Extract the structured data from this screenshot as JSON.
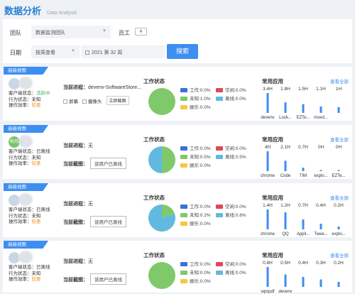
{
  "header": {
    "title": "数据分析",
    "subtitle": "Data Analysis"
  },
  "filter": {
    "team_label": "团队",
    "team_value": "数据监测团队",
    "member_label": "员工",
    "add_label": "+",
    "date_label": "日期",
    "date_mode": "按周查看",
    "week_value": "2021 第 32 周",
    "search_label": "搜索"
  },
  "colors": {
    "work": "#3d6fd8",
    "idle": "#e2465a",
    "unknown": "#7fc96a",
    "offline": "#62b9df",
    "entertain": "#f5c842",
    "accent": "#3d8ef0"
  },
  "labels": {
    "badge": "高级视图",
    "client_status": "客户端状态：",
    "behavior_status": "行为状态：",
    "efficiency": "操作效率：",
    "current_process": "当前进程：",
    "current_screenshot": "当前截图：",
    "request_screenshot": "该用户已离线",
    "work_status": "工作状态",
    "common_apps": "常用应用",
    "view_all": "查看全部",
    "screen": "屏幕",
    "camera": "摄像头",
    "instant_capture": "立即截图"
  },
  "cards": [
    {
      "avatar_text": "",
      "client_status": "活跃中",
      "client_status_kind": "ok",
      "behavior_status": "未知",
      "efficiency": "较差",
      "process": "devenv-SoftwareStore...",
      "has_checks": true,
      "legend": {
        "work": "工作:0.0%",
        "idle": "空闲:0.0%",
        "unknown": "未知:1.0%",
        "offline": "离线:0.0%",
        "entertain": "娱乐:0.0%"
      },
      "pie": [
        {
          "key": "unknown",
          "value": 100
        }
      ],
      "chart_data": {
        "type": "bar",
        "categories": [
          "devenv",
          "Lock...",
          "EZTe...",
          "msed...",
          ""
        ],
        "values": [
          3.4,
          1.8,
          1.5,
          1.1,
          1
        ],
        "labels": [
          "3.4H",
          "1.8H",
          "1.5H",
          "1.1H",
          "1H"
        ]
      }
    },
    {
      "avatar_text": "秋月",
      "client_status": "已离线",
      "client_status_kind": "v",
      "behavior_status": "未知",
      "efficiency": "较差",
      "process": "无",
      "has_checks": false,
      "legend": {
        "work": "工作:0.0%",
        "idle": "空闲:0.0%",
        "unknown": "未知:0.5%",
        "offline": "离线:0.5%",
        "entertain": "娱乐:0.0%"
      },
      "pie": [
        {
          "key": "unknown",
          "value": 50
        },
        {
          "key": "offline",
          "value": 50
        }
      ],
      "chart_data": {
        "type": "bar",
        "categories": [
          "chrome",
          "Code",
          "TIM",
          "explo...",
          "EZTe..."
        ],
        "values": [
          4,
          2.1,
          0.7,
          0,
          0
        ],
        "labels": [
          "4H",
          "2.1H",
          "0.7H",
          "0H",
          "0H"
        ]
      }
    },
    {
      "avatar_text": "",
      "client_status": "已离线",
      "client_status_kind": "v",
      "behavior_status": "未知",
      "efficiency": "较差",
      "process": "无",
      "has_checks": false,
      "legend": {
        "work": "工作:0.0%",
        "idle": "空闲:0.0%",
        "unknown": "未知:0.2%",
        "offline": "离线:0.8%",
        "entertain": "娱乐:0.0%"
      },
      "pie": [
        {
          "key": "unknown",
          "value": 20
        },
        {
          "key": "offline",
          "value": 80
        }
      ],
      "chart_data": {
        "type": "bar",
        "categories": [
          "chrome",
          "QQ",
          "Appli...",
          "Twee...",
          "explo..."
        ],
        "values": [
          1.4,
          1.2,
          0.7,
          0.4,
          0.2
        ],
        "labels": [
          "1.4H",
          "1.2H",
          "0.7H",
          "0.4H",
          "0.2H"
        ]
      }
    },
    {
      "avatar_text": "",
      "client_status": "已离线",
      "client_status_kind": "v",
      "behavior_status": "未知",
      "efficiency": "较差",
      "process": "无",
      "has_checks": false,
      "legend": {
        "work": "工作:0.0%",
        "idle": "空闲:0.0%",
        "unknown": "未知:0.0%",
        "offline": "离线:0.0%",
        "entertain": "娱乐:0.0%"
      },
      "pie": [
        {
          "key": "unknown",
          "value": 100
        }
      ],
      "chart_data": {
        "type": "bar",
        "categories": [
          "wpspdf",
          "devenv",
          "",
          "",
          ""
        ],
        "values": [
          0.8,
          0.5,
          0.4,
          0.3,
          0.2
        ],
        "labels": [
          "0.8H",
          "0.5H",
          "0.4H",
          "0.3H",
          "0.2H"
        ]
      }
    }
  ]
}
